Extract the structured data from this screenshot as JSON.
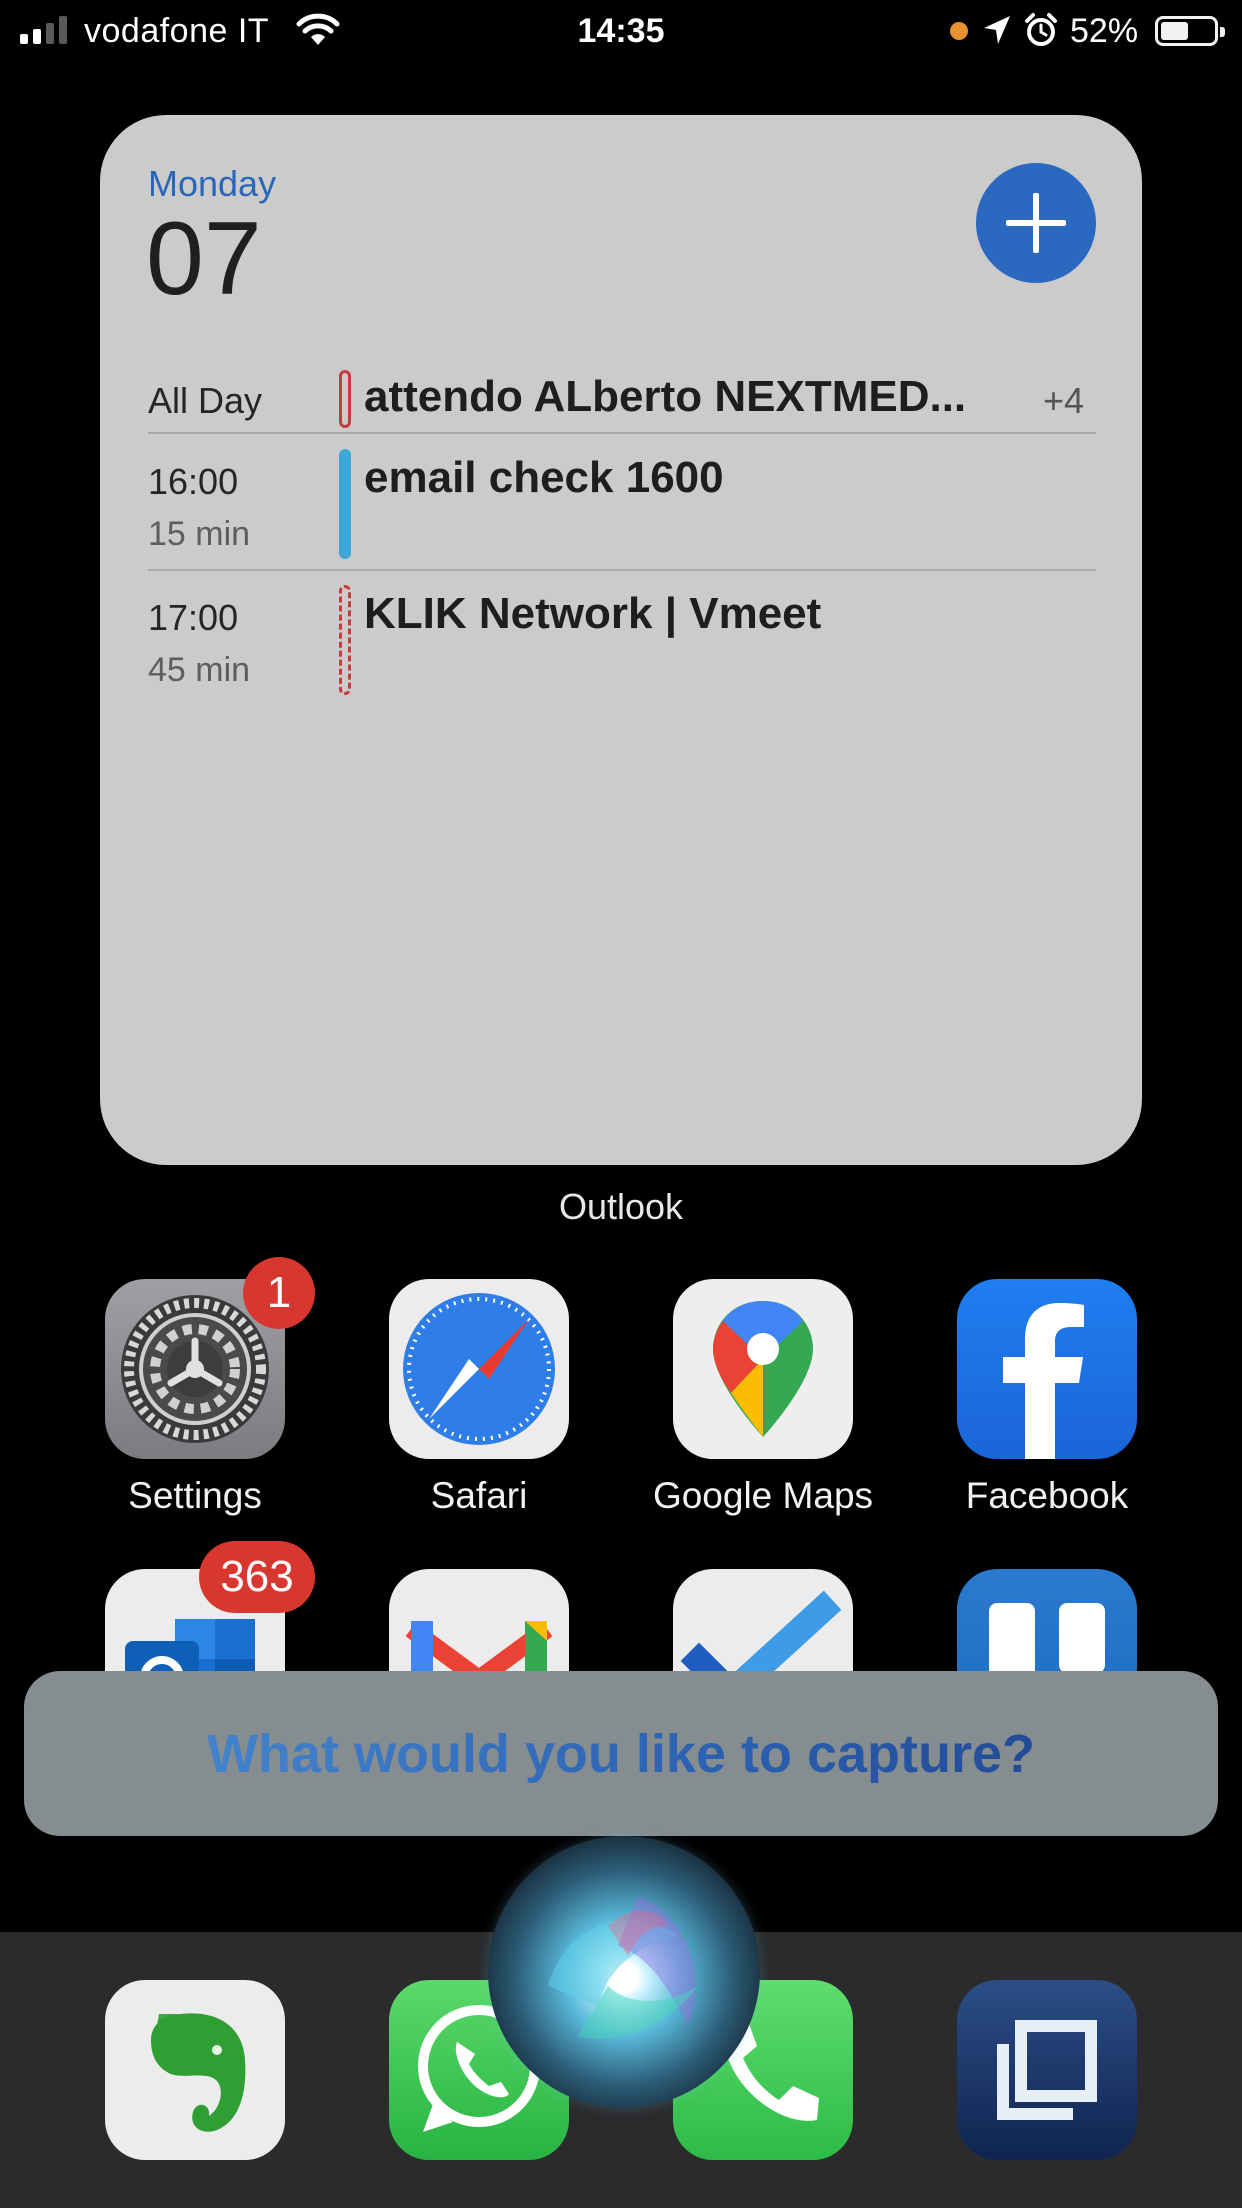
{
  "status_bar": {
    "carrier": "vodafone IT",
    "time": "14:35",
    "battery_percent": "52%",
    "battery_level": 0.52
  },
  "widget": {
    "day_name": "Monday",
    "day_number": "07",
    "label": "Outlook",
    "events": [
      {
        "time": "All Day",
        "duration": "",
        "title": "attendo ALberto NEXTMED...",
        "more": "+4",
        "bar_style": "outline",
        "bar_color": "#c33d3d"
      },
      {
        "time": "16:00",
        "duration": "15 min",
        "title": "email check 1600",
        "more": "",
        "bar_style": "solid",
        "bar_color": "#3fa7d6"
      },
      {
        "time": "17:00",
        "duration": "45 min",
        "title": "KLIK Network | Vmeet",
        "more": "",
        "bar_style": "dashed",
        "bar_color": "#c33d3d"
      }
    ]
  },
  "apps": [
    {
      "name": "Settings",
      "badge": "1",
      "icon": "settings-gear-icon"
    },
    {
      "name": "Safari",
      "badge": "",
      "icon": "safari-compass-icon"
    },
    {
      "name": "Google Maps",
      "badge": "",
      "icon": "google-maps-pin-icon"
    },
    {
      "name": "Facebook",
      "badge": "",
      "icon": "facebook-f-icon"
    }
  ],
  "apps_row2": [
    {
      "badge": "363",
      "icon": "outlook-icon"
    },
    {
      "badge": "",
      "icon": "gmail-icon"
    },
    {
      "badge": "",
      "icon": "microsoft-todo-icon"
    },
    {
      "badge": "",
      "icon": "trello-icon"
    }
  ],
  "siri": {
    "prompt": "What would you like to capture?"
  },
  "dock": [
    {
      "icon": "evernote-icon"
    },
    {
      "icon": "whatsapp-icon"
    },
    {
      "icon": "phone-icon"
    },
    {
      "icon": "screens-icon"
    }
  ],
  "colors": {
    "accent_blue": "#2a69bf",
    "badge_red": "#d8372f",
    "widget_bg": "#cbcbcb"
  }
}
